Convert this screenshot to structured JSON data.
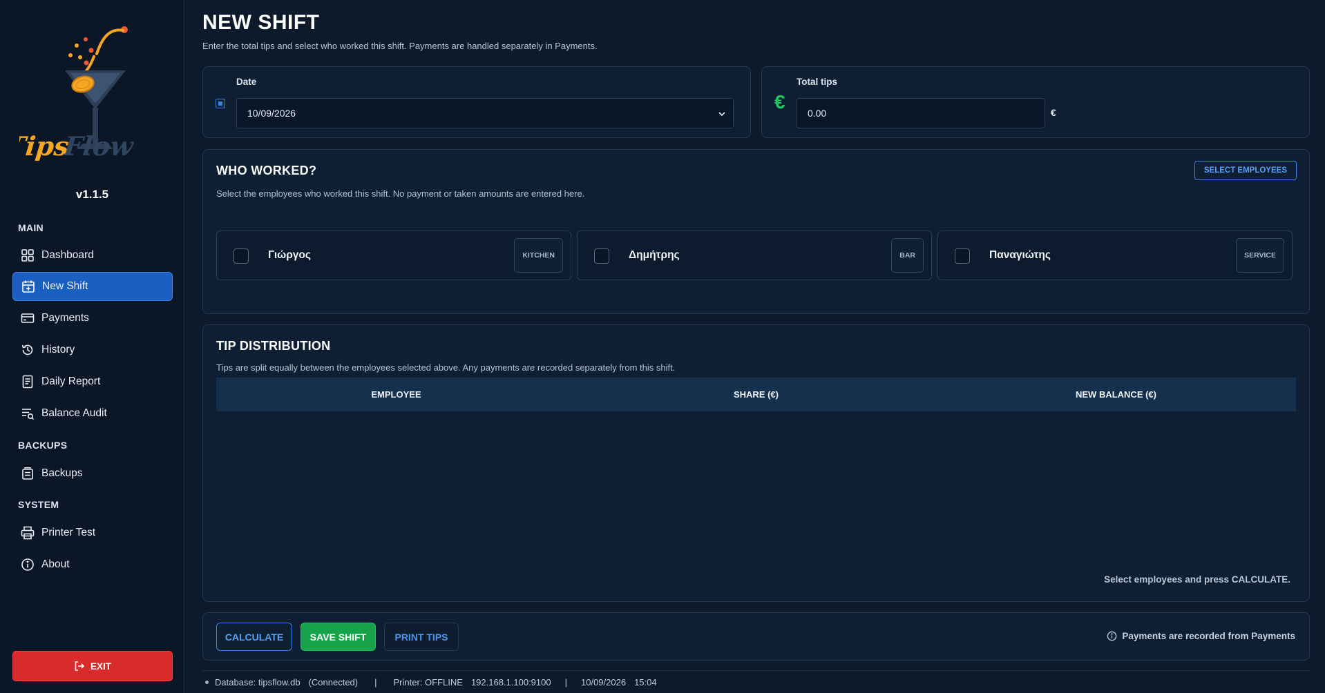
{
  "app": {
    "name": "TipsFlow",
    "version": "v1.1.5"
  },
  "sidebar": {
    "sections": {
      "main": "MAIN",
      "backups": "BACKUPS",
      "system": "SYSTEM"
    },
    "items": [
      {
        "label": "Dashboard",
        "icon": "grid-icon",
        "active": false
      },
      {
        "label": "New Shift",
        "icon": "calendar-plus-icon",
        "active": true
      },
      {
        "label": "Payments",
        "icon": "credit-card-icon",
        "active": false
      },
      {
        "label": "History",
        "icon": "history-icon",
        "active": false
      },
      {
        "label": "Daily Report",
        "icon": "report-icon",
        "active": false
      },
      {
        "label": "Balance Audit",
        "icon": "audit-icon",
        "active": false
      },
      {
        "label": "Backups",
        "icon": "backup-icon",
        "active": false
      },
      {
        "label": "Printer Test",
        "icon": "printer-icon",
        "active": false
      },
      {
        "label": "About",
        "icon": "info-icon",
        "active": false
      }
    ],
    "exit_label": "EXIT"
  },
  "page": {
    "title": "NEW SHIFT",
    "subtitle": "Enter the total tips and select who worked this shift. Payments are handled separately in Payments."
  },
  "date_card": {
    "label": "Date",
    "value": "10/09/2026"
  },
  "tips_card": {
    "label": "Total tips",
    "currency_symbol": "€",
    "value": "0.00",
    "suffix": "€"
  },
  "who_worked": {
    "title": "WHO WORKED?",
    "description": "Select the employees who worked this shift. No payment or taken amounts are entered here.",
    "select_button": "SELECT EMPLOYEES",
    "employees": [
      {
        "name": "Γιώργος",
        "role": "KITCHEN",
        "checked": false
      },
      {
        "name": "Δημήτρης",
        "role": "BAR",
        "checked": false
      },
      {
        "name": "Παναγιώτης",
        "role": "SERVICE",
        "checked": false
      }
    ]
  },
  "distribution": {
    "title": "TIP DISTRIBUTION",
    "description": "Tips are split equally between the employees selected above. Any payments are recorded separately from this shift.",
    "columns": [
      "EMPLOYEE",
      "SHARE (€)",
      "NEW BALANCE (€)"
    ],
    "rows": [],
    "hint": "Select employees and press CALCULATE."
  },
  "actions": {
    "calculate": "CALCULATE",
    "save": "SAVE SHIFT",
    "print": "PRINT TIPS",
    "note": "Payments are recorded from Payments"
  },
  "status": {
    "database": "Database: tipsflow.db",
    "db_state": "(Connected)",
    "printer": "Printer: OFFLINE",
    "printer_addr": "192.168.1.100:9100",
    "date": "10/09/2026",
    "time": "15:04"
  },
  "colors": {
    "accent": "#1a5fc2",
    "success": "#16a34a",
    "danger": "#d92b2b",
    "brand_orange": "#f5a623",
    "euro_green": "#22c55e"
  }
}
